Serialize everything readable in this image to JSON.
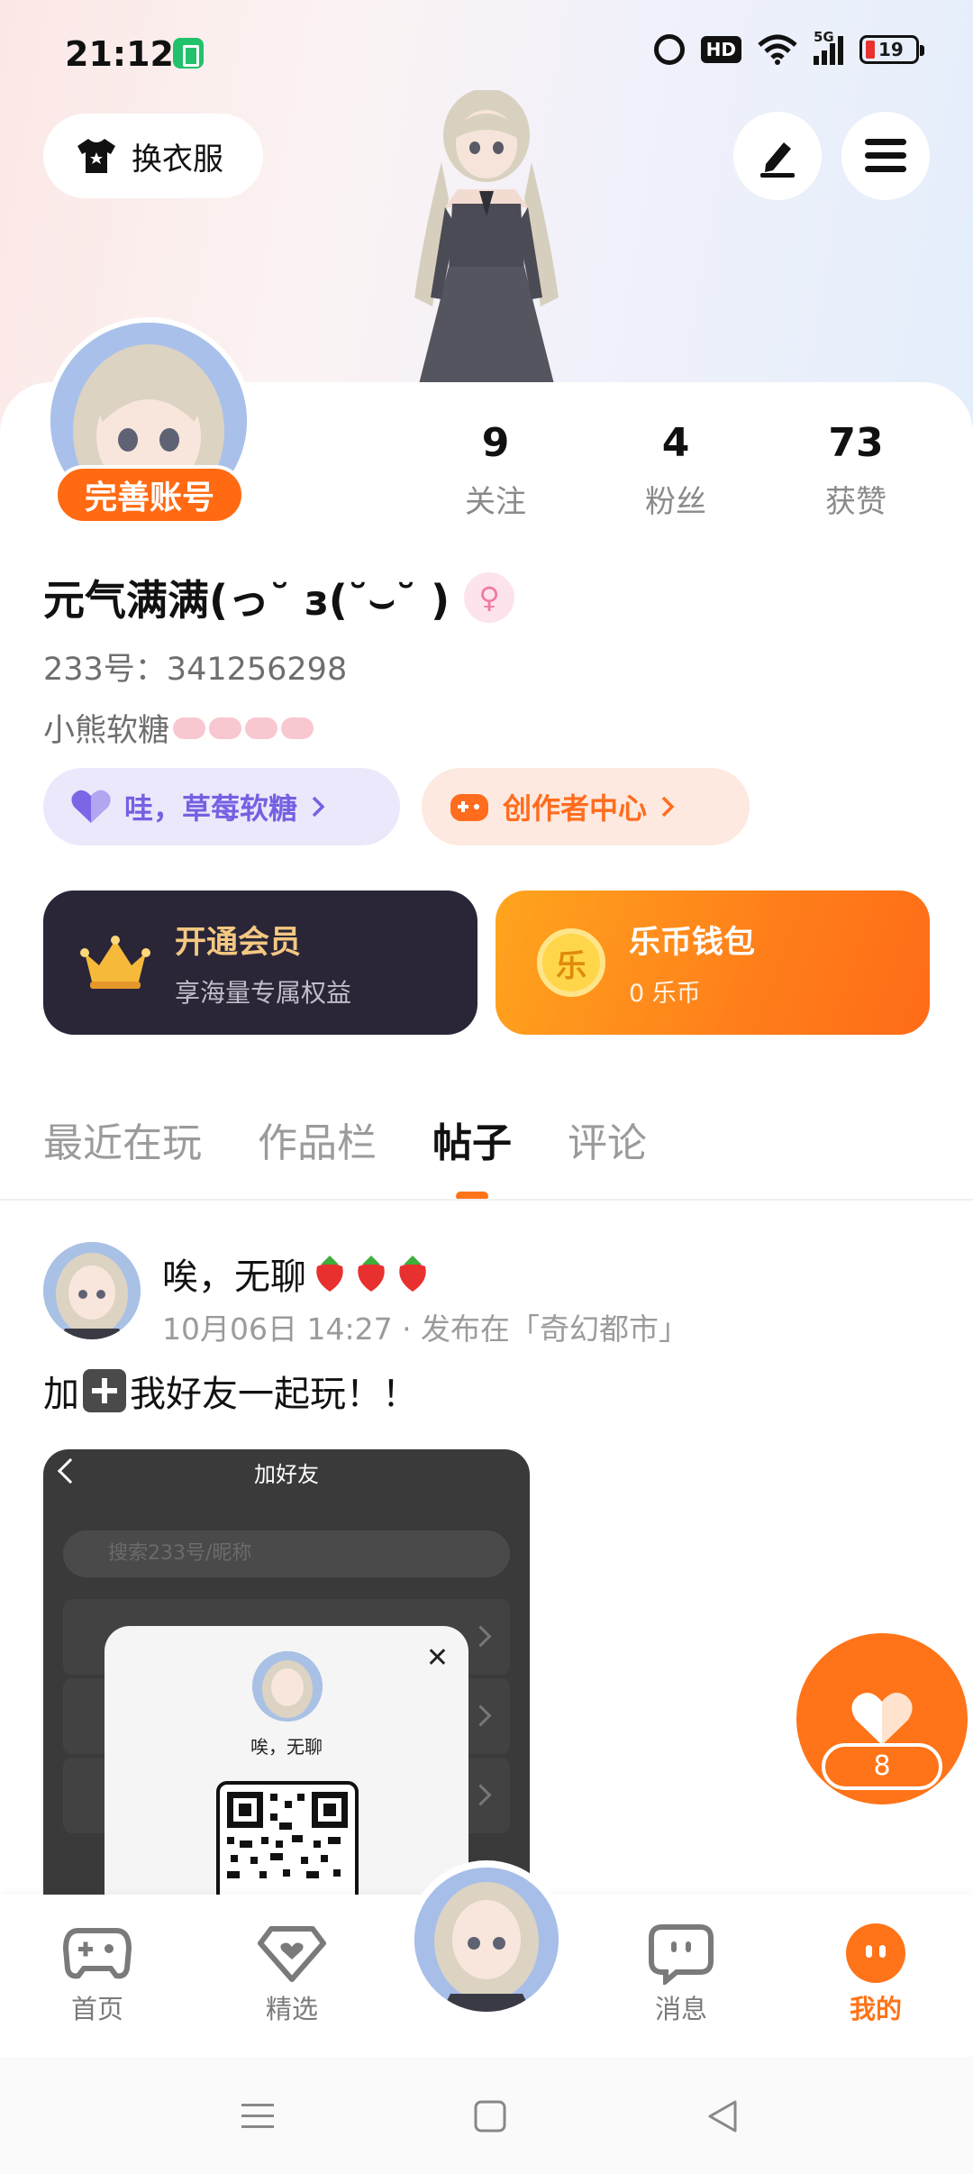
{
  "status_bar": {
    "time": "21:12",
    "hd_label": "HD",
    "network_label": "5G",
    "battery_level": "19"
  },
  "header": {
    "dress_up_label": "换衣服",
    "edit_icon": "pencil-icon",
    "menu_icon": "hamburger-menu-icon"
  },
  "profile": {
    "complete_badge": "完善账号",
    "nickname": "元气满满(っ˘ з(˘⌣˘ )",
    "gender_symbol": "♀",
    "uid_line": "233号：341256298",
    "bio": "小熊软糖",
    "stats": [
      {
        "value": "9",
        "label": "关注"
      },
      {
        "value": "4",
        "label": "粉丝"
      },
      {
        "value": "73",
        "label": "获赞"
      }
    ]
  },
  "pills": {
    "sweet": "哇，草莓软糖",
    "creator": "创作者中心"
  },
  "cards": {
    "vip_title": "开通会员",
    "vip_sub": "享海量专属权益",
    "wallet_title": "乐币钱包",
    "wallet_sub": "0 乐币",
    "coin_char": "乐"
  },
  "tabs": [
    {
      "label": "最近在玩",
      "active": false
    },
    {
      "label": "作品栏",
      "active": false
    },
    {
      "label": "帖子",
      "active": true
    },
    {
      "label": "评论",
      "active": false
    }
  ],
  "post": {
    "title": "唉，无聊",
    "meta": "10月06日 14:27 · 发布在「奇幻都市」",
    "text_before": "加",
    "text_after": "我好友一起玩！！",
    "image": {
      "header": "加好友",
      "search_placeholder": "搜索233号/昵称",
      "popup_name": "唉，无聊"
    }
  },
  "like": {
    "count": "8"
  },
  "bottom_nav": [
    {
      "label": "首页",
      "icon": "gamepad-icon",
      "active": false
    },
    {
      "label": "精选",
      "icon": "heart-gem-icon",
      "active": false
    },
    {
      "label": "消息",
      "icon": "chat-bubble-icon",
      "active": false
    },
    {
      "label": "我的",
      "icon": "profile-face-icon",
      "active": true
    }
  ],
  "colors": {
    "accent": "#ff7418",
    "vip_bg": "#2a2638",
    "vip_text": "#f4c882",
    "sweet_text": "#7461e2",
    "creator_text": "#ff6c1e"
  }
}
